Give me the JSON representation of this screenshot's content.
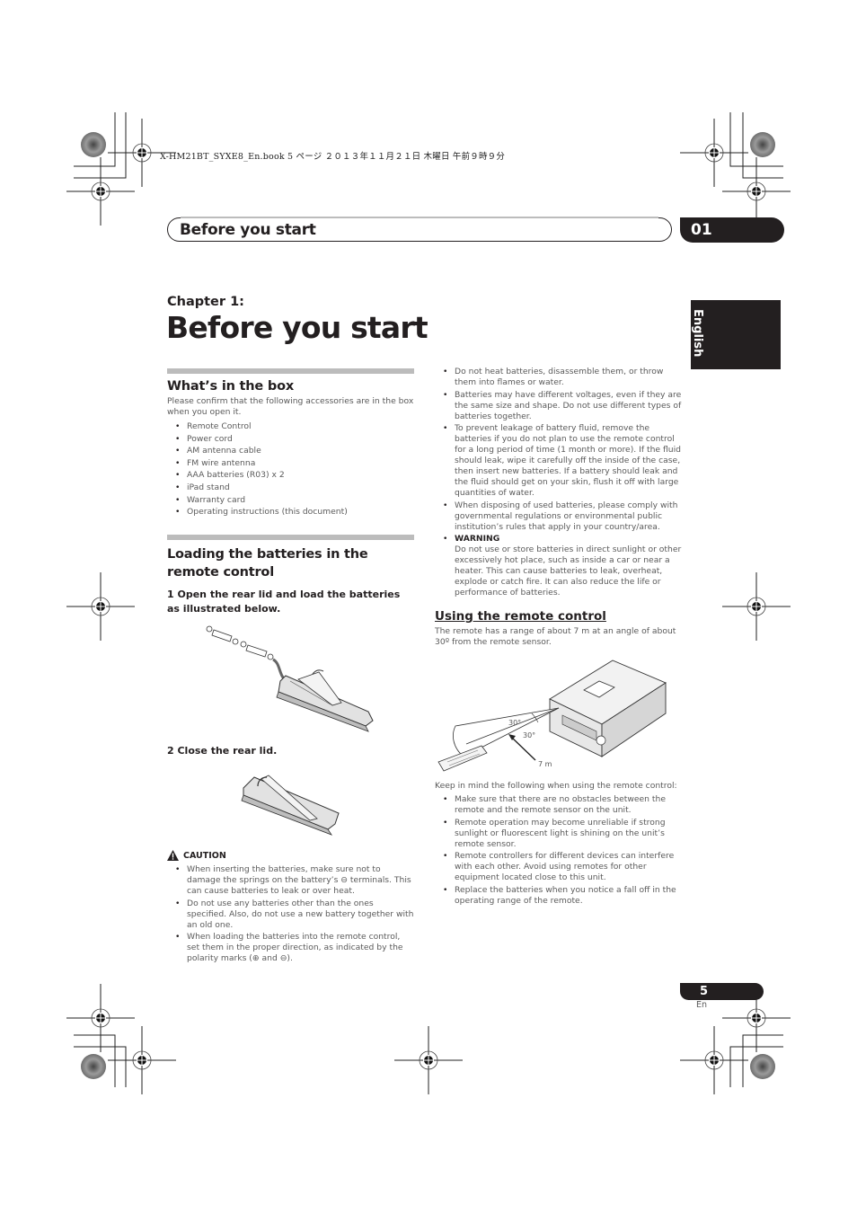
{
  "slug_line": "X-HM21BT_SYXE8_En.book  5 ページ  ２０１３年１１月２１日  木曜日  午前９時９分",
  "header": {
    "title": "Before you start",
    "chapter_number": "01"
  },
  "language_tab": "English",
  "chapter": {
    "label": "Chapter 1:",
    "title": "Before you start"
  },
  "whats_in_box": {
    "heading": "What’s in the box",
    "intro": "Please confirm that the following accessories are in the box when you open it.",
    "items": [
      "Remote Control",
      "Power cord",
      "AM antenna cable",
      "FM wire antenna",
      "AAA batteries (R03) x 2",
      "iPad stand",
      "Warranty card",
      "Operating instructions (this document)"
    ]
  },
  "loading_batteries": {
    "heading": "Loading the batteries in the remote control",
    "step1": "1    Open the rear lid and load the batteries as illustrated below.",
    "step2": "2    Close the rear lid.",
    "illustration1": "remote-open-lid-batteries",
    "illustration2": "remote-close-lid"
  },
  "caution": {
    "label": "CAUTION",
    "icon": "warning-triangle-icon",
    "items": [
      "When inserting the batteries, make sure not to damage the springs on the battery’s ⊖ terminals. This can cause batteries to leak or over heat.",
      "Do not use any batteries other than the ones specified. Also, do not use a new battery together with an old one.",
      "When loading the batteries into the remote control, set them in the proper direction, as indicated by the polarity marks (⊕ and ⊖)."
    ]
  },
  "battery_notes": [
    "Do not heat batteries, disassemble them, or throw them into flames or water.",
    "Batteries may have different voltages, even if they are the same size and shape. Do not use different types of batteries together.",
    "To prevent leakage of battery fluid, remove the batteries if you do not plan to use the remote control for a long period of time (1 month or more). If the fluid should leak, wipe it carefully off the inside of the case, then insert new batteries. If a battery should leak and the fluid should get on your skin, flush it off with large quantities of water.",
    "When disposing of used batteries, please comply with governmental regulations or environmental public institution’s rules that apply in your country/area."
  ],
  "warning": {
    "label": "WARNING",
    "text": "Do not use or store batteries in direct sunlight or other excessively hot place, such as inside a car or near a heater. This can cause batteries to leak, overheat, explode or catch fire. It can also reduce the life or performance of batteries."
  },
  "using_remote": {
    "heading": "Using the remote control",
    "intro": "The remote has a range of about 7 m at an angle of about 30º from the remote sensor.",
    "diagram": {
      "angle_label_1": "30°",
      "angle_label_2": "30°",
      "distance_label": "7 m"
    },
    "keep_in_mind": "Keep in mind the following when using the remote control:",
    "items": [
      "Make sure that there are no obstacles between the remote and the remote sensor on the unit.",
      "Remote operation may become unreliable if strong sunlight or fluorescent light is shining on the unit’s remote sensor.",
      "Remote controllers for different devices can interfere with each other. Avoid using remotes for other equipment located close to this unit.",
      "Replace the batteries when you notice a fall off in the operating range of the remote."
    ]
  },
  "footer": {
    "page_number": "5",
    "language": "En"
  }
}
